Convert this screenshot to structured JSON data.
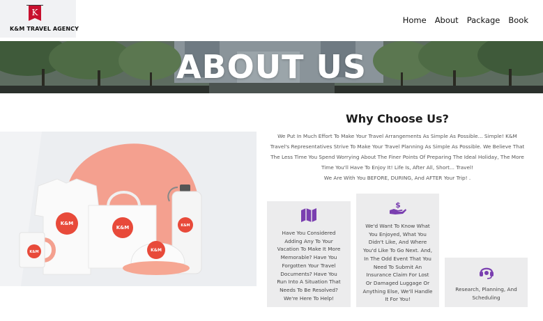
{
  "brand": {
    "name": "K&M TRAVEL AGENCY",
    "flag_letter": "K"
  },
  "nav": {
    "items": [
      "Home",
      "About",
      "Package",
      "Book"
    ]
  },
  "banner": {
    "title": "ABOUT US"
  },
  "merch": {
    "logo_text": "K&M"
  },
  "why": {
    "title": "Why Choose Us?",
    "intro_lines": [
      "We Put In Much Effort To Make Your Travel Arrangements As Simple As Possible... Simple! K&M",
      "Travel's Representatives Strive To Make Your Travel Planning As Simple As Possible. We Believe That",
      "The Less Time You Spend Worrying About The Finer Points Of Preparing The Ideal Holiday, The More",
      "Time You'll Have To Enjoy It! Life Is, After All, Short... Travel!",
      "We Are With You BEFORE, DURING, And AFTER Your Trip! ."
    ]
  },
  "cards": [
    {
      "icon": "map-icon",
      "lines": [
        "Have You Considered",
        "Adding Any To Your",
        "Vacation To Make It More",
        "Memorable? Have You",
        "Forgotten Your Travel",
        "Documents? Have You",
        "Run Into A Situation That",
        "Needs To Be Resolved?",
        "We're Here To Help!"
      ]
    },
    {
      "icon": "hand-dollar-icon",
      "lines": [
        "We'd Want To Know What",
        "You Enjoyed, What You",
        "Didn't Like, And Where",
        "You'd Like To Go Next. And,",
        "In The Odd Event That You",
        "Need To Submit An",
        "Insurance Claim For Lost",
        "Or Damaged Luggage Or",
        "Anything Else, We'll Handle",
        "It For You!"
      ]
    },
    {
      "icon": "headset-icon",
      "lines": [
        "Research, Planning, And",
        "Scheduling"
      ]
    }
  ],
  "colors": {
    "accent": "#7a3fb0",
    "brand_red": "#c8102e",
    "coral": "#f4a08f"
  }
}
